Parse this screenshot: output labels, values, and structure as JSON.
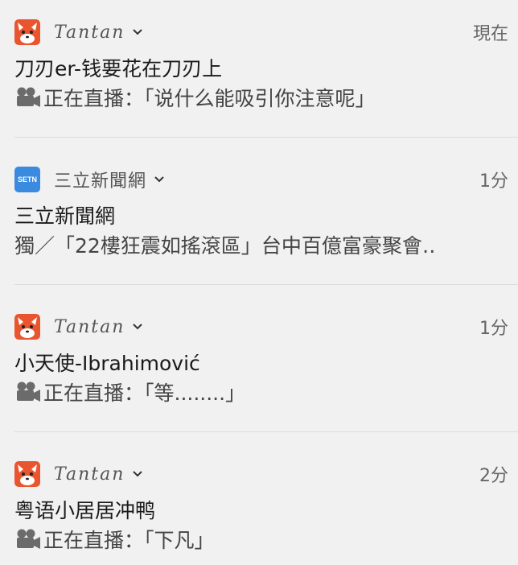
{
  "notifications": [
    {
      "app": "Tantan",
      "app_icon": "tantan-fox-icon",
      "time": "現在",
      "title": "刀刃er-钱要花在刀刃上",
      "body": "正在直播：「说什么能吸引你注意呢」",
      "body_icon": "video-camera-icon"
    },
    {
      "app": "三立新聞網",
      "app_icon": "setn-logo-icon",
      "app_icon_text": "SETN",
      "time": "1分",
      "title": "三立新聞網",
      "body": "獨／「22樓狂震如搖滾區」台中百億富豪聚會‥"
    },
    {
      "app": "Tantan",
      "app_icon": "tantan-fox-icon",
      "time": "1分",
      "title": "小天使-Ibrahimović",
      "body": "正在直播：「等........」",
      "body_icon": "video-camera-icon"
    },
    {
      "app": "Tantan",
      "app_icon": "tantan-fox-icon",
      "time": "2分",
      "title": "粤语小居居冲鸭",
      "body": "正在直播：「下凡」",
      "body_icon": "video-camera-icon"
    }
  ],
  "colors": {
    "background": "#f1f1f1",
    "tantan_brand": "#e8552f",
    "setn_brand": "#3a8be0"
  }
}
